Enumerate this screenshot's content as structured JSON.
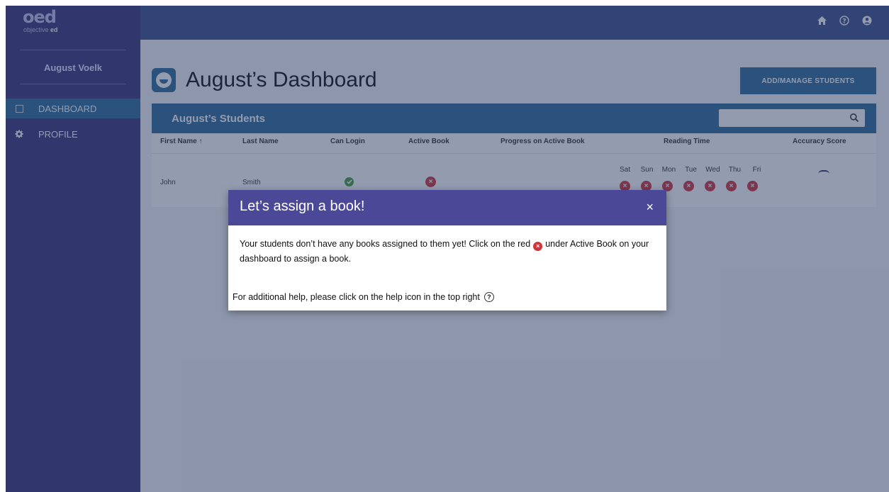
{
  "logo": {
    "mark": "oed",
    "sub_prefix": "objective",
    "sub_brand": "ed"
  },
  "sidebar": {
    "user_name": "August Voelk",
    "items": [
      {
        "label": "DASHBOARD",
        "icon": "dashboard-icon",
        "active": true
      },
      {
        "label": "PROFILE",
        "icon": "gear-icon",
        "active": false
      }
    ]
  },
  "topbar": {
    "icons": [
      "home-icon",
      "help-icon",
      "account-icon"
    ]
  },
  "dashboard": {
    "title": "August’s Dashboard",
    "add_button_label": "ADD/MANAGE STUDENTS",
    "students_title": "August’s Students",
    "search": {
      "value": "",
      "placeholder": ""
    },
    "columns": [
      "First Name ↑",
      "Last Name",
      "Can Login",
      "Active Book",
      "Progress on Active Book",
      "Reading Time",
      "Accuracy Score"
    ],
    "days": [
      "Sat",
      "Sun",
      "Mon",
      "Tue",
      "Wed",
      "Thu",
      "Fri"
    ],
    "rows": [
      {
        "first_name": "John",
        "last_name": "Smith",
        "can_login": true,
        "active_book": false
      }
    ]
  },
  "modal": {
    "title": "Let’s assign a book!",
    "close_label": "×",
    "body_before": "Your students don’t have any books assigned to them yet! Click on the red",
    "body_after": "under Active Book on your dashboard to assign a book.",
    "help_text": "For additional help, please click on the help icon in the top right"
  },
  "colors": {
    "sidebar": "#3a3578",
    "topbar": "#3d4e8c",
    "accent": "#2c6d9a",
    "modal_header": "#4b4898",
    "error": "#d0343c",
    "success": "#4a9d46"
  }
}
